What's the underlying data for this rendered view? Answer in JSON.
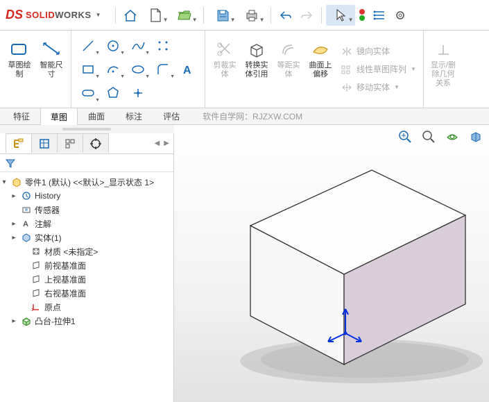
{
  "app": {
    "brand_ds": "DS",
    "brand_solid": "SOLID",
    "brand_works": "WORKS"
  },
  "tabs": {
    "t0": "特征",
    "t1": "草图",
    "t2": "曲面",
    "t3": "标注",
    "t4": "评估"
  },
  "watermark": "软件自学网：RJZXW.COM",
  "rb": {
    "sketch": "草图绘\n制",
    "smartdim": "智能尺\n寸",
    "trim": "剪裁实\n体",
    "convert": "转换实\n体引用",
    "offset": "等距实\n体",
    "surfoff": "曲面上\n偏移",
    "mirror": "镜向实体",
    "linpat": "线性草图阵列",
    "move": "移动实体",
    "showrel": "显示/删\n除几何\n关系"
  },
  "tree": {
    "root": "零件1 (默认) <<默认>_显示状态 1>",
    "history": "History",
    "sensor": "传感器",
    "annot": "注解",
    "solid": "实体(1)",
    "material": "材质 <未指定>",
    "front": "前视基准面",
    "top": "上视基准面",
    "right": "右视基准面",
    "origin": "原点",
    "extrude": "凸台-拉伸1"
  }
}
